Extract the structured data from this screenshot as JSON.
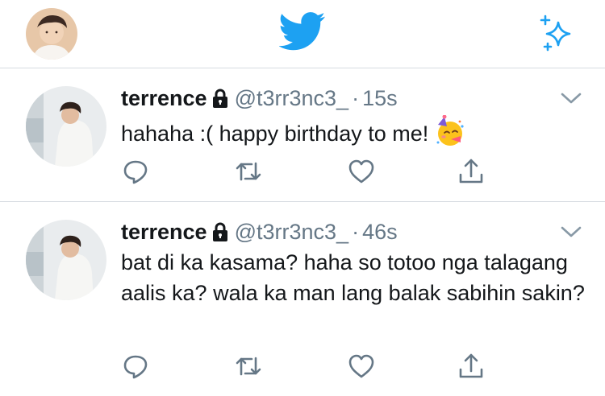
{
  "header": {
    "logo_icon": "twitter-bird-icon",
    "compose_icon": "sparkle-icon",
    "accent": "#1da1f2"
  },
  "tweets": [
    {
      "name": "terrence",
      "handle": "@t3rr3nc3_",
      "separator": "·",
      "time": "15s",
      "text": "hahaha :( happy birthday to me!",
      "emoji": "partying-face-icon"
    },
    {
      "name": "terrence",
      "handle": "@t3rr3nc3_",
      "separator": "·",
      "time": "46s",
      "text": "bat di ka kasama? haha so totoo nga talagang aalis ka? wala ka man lang balak sabihin sakin?"
    }
  ],
  "colors": {
    "text": "#14171a",
    "secondary": "#657786",
    "divider": "#d6dbe0"
  }
}
